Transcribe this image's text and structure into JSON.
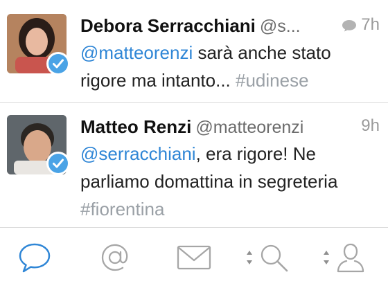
{
  "colors": {
    "accent": "#2f86d6",
    "muted": "#9aa0a6",
    "verified": "#4aa3e6"
  },
  "tweets": [
    {
      "name": "Debora Serracchiani",
      "handle": "@s...",
      "time": "7h",
      "has_reply_icon": true,
      "verified": true,
      "text": {
        "mention": "@matteorenzi",
        "body": " sarà anche stato rigore ma intanto... ",
        "hashtag": "#udinese"
      }
    },
    {
      "name": "Matteo Renzi",
      "handle": "@matteorenzi",
      "time": "9h",
      "verified": true,
      "text": {
        "mention": "@serracchiani",
        "body": ", era rigore! Ne parliamo domattina in segreteria ",
        "hashtag": "#fiorentina"
      }
    }
  ],
  "tabbar": {
    "items": [
      {
        "icon": "speech-bubble-icon",
        "active": true
      },
      {
        "icon": "at-sign-icon",
        "active": false
      },
      {
        "icon": "envelope-icon",
        "active": false
      },
      {
        "icon": "search-icon",
        "active": false
      },
      {
        "icon": "person-icon",
        "active": false
      }
    ]
  }
}
